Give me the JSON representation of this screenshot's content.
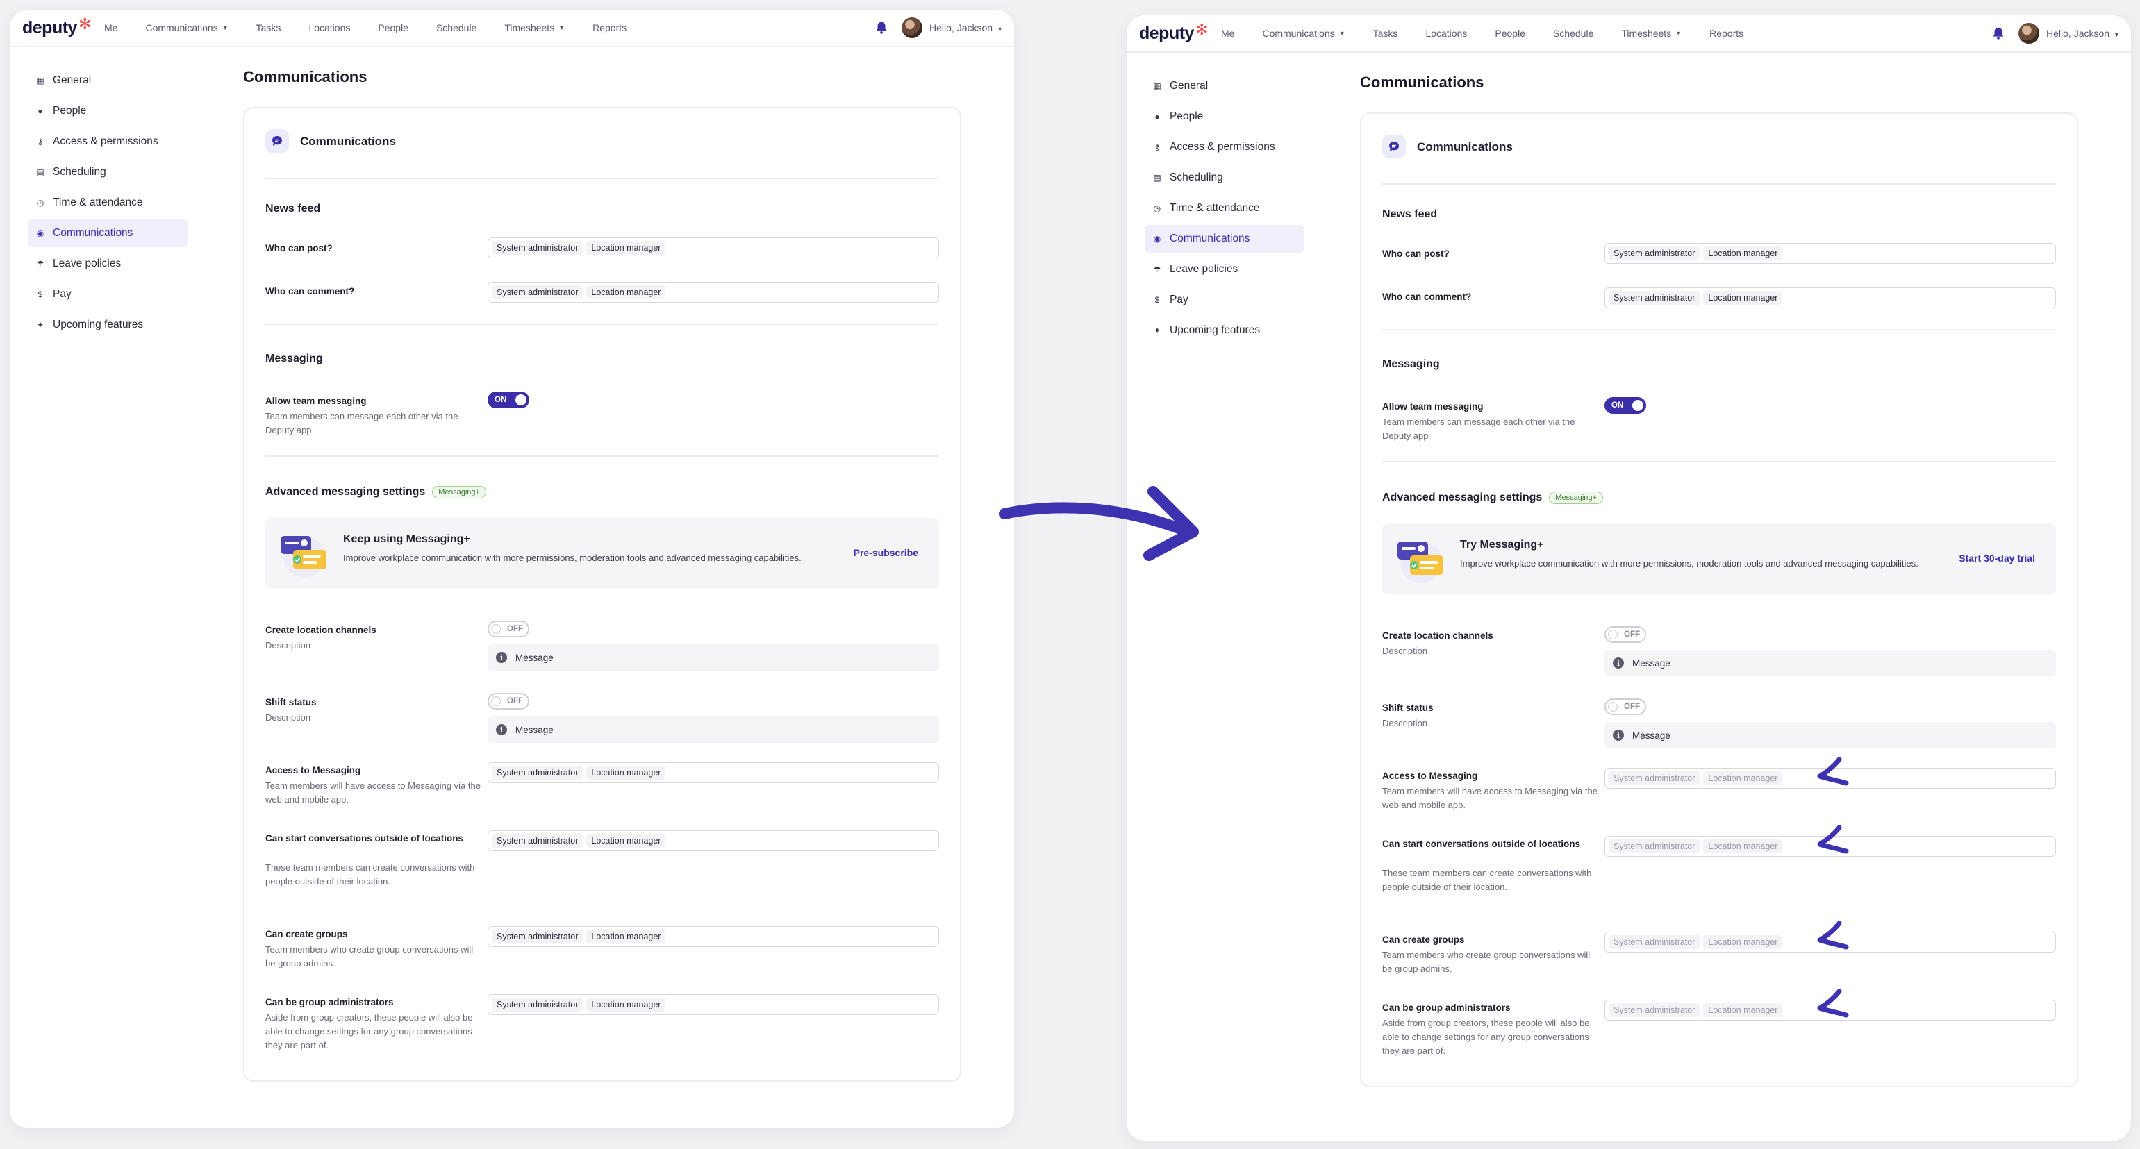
{
  "nav": {
    "logo": "deputy",
    "logo_mark": "✻",
    "items": [
      "Me",
      "Communications",
      "Tasks",
      "Locations",
      "People",
      "Schedule",
      "Timesheets",
      "Reports"
    ],
    "greeting": "Hello, Jackson"
  },
  "sidebar": {
    "items": [
      {
        "label": "General",
        "icon": "building-icon"
      },
      {
        "label": "People",
        "icon": "person-icon"
      },
      {
        "label": "Access & permissions",
        "icon": "key-icon"
      },
      {
        "label": "Scheduling",
        "icon": "calendar-icon"
      },
      {
        "label": "Time & attendance",
        "icon": "clock-icon"
      },
      {
        "label": "Communications",
        "icon": "chat-icon"
      },
      {
        "label": "Leave policies",
        "icon": "palm-tree-icon"
      },
      {
        "label": "Pay",
        "icon": "dollar-icon"
      },
      {
        "label": "Upcoming features",
        "icon": "sparkle-icon"
      }
    ],
    "active": "Communications"
  },
  "page": {
    "title": "Communications",
    "card_title": "Communications",
    "news_feed": {
      "heading": "News feed",
      "who_can_post": "Who can post?",
      "who_can_comment": "Who can comment?"
    },
    "messaging": {
      "heading": "Messaging",
      "allow_label": "Allow team messaging",
      "allow_desc": "Team members can message each other via the Deputy app",
      "toggle_on": "ON"
    },
    "advanced": {
      "heading": "Advanced messaging settings",
      "badge": "Messaging+",
      "promo_text": "Improve workplace communication with more permissions, moderation tools and advanced messaging capabilities."
    },
    "create_channels": {
      "label": "Create location channels",
      "desc": "Description"
    },
    "shift_status": {
      "label": "Shift status",
      "desc": "Description"
    },
    "toggle_off": "OFF",
    "info_message": "Message",
    "access": {
      "label": "Access to Messaging",
      "desc": "Team members will have access to Messaging via the web and mobile app."
    },
    "start_conv": {
      "label": "Can start conversations outside of locations",
      "desc": "These team members can create conversations with people outside of their location."
    },
    "create_groups": {
      "label": "Can create groups",
      "desc": "Team members who create group conversations will be group admins."
    },
    "group_admins": {
      "label": "Can be group administrators",
      "desc": "Aside from group creators, these people will also be able to change settings for any group conversations they are part of."
    },
    "chips": [
      "System administrator",
      "Location manager"
    ]
  },
  "left_variant": {
    "promo_title": "Keep using Messaging+",
    "promo_cta": "Pre-subscribe"
  },
  "right_variant": {
    "promo_title": "Try Messaging+",
    "promo_cta": "Start 30-day trial"
  },
  "colors": {
    "primary": "#3a2fa8",
    "annotation": "#3d32b0",
    "logo_star": "#ef4b4b"
  }
}
